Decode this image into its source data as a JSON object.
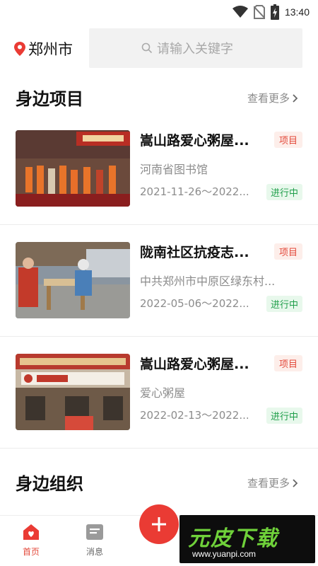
{
  "status_bar": {
    "time": "13:40"
  },
  "header": {
    "city": "郑州市",
    "search_placeholder": "请输入关键字"
  },
  "projects_section": {
    "title": "身边项目",
    "more": "查看更多"
  },
  "projects": [
    {
      "title": "嵩山路爱心粥屋...",
      "tag": "项目",
      "org": "河南省图书馆",
      "date": "2021-11-26～2022...",
      "status": "进行中"
    },
    {
      "title": "陇南社区抗疫志...",
      "tag": "项目",
      "org": "中共郑州市中原区绿东村...",
      "date": "2022-05-06～2022...",
      "status": "进行中"
    },
    {
      "title": "嵩山路爱心粥屋...",
      "tag": "项目",
      "org": "爱心粥屋",
      "date": "2022-02-13～2022...",
      "status": "进行中"
    }
  ],
  "orgs_section": {
    "title": "身边组织",
    "more": "查看更多"
  },
  "tab_bar": {
    "home": "首页",
    "messages": "消息"
  },
  "watermark": {
    "brand": "元皮下载",
    "url": "www.yuanpi.com"
  },
  "colors": {
    "accent": "#ea3b34",
    "tag_bg": "#fdeeea",
    "status_green": "#1f9e4a",
    "status_bg": "#e8f8ec"
  },
  "icons": [
    "wifi-icon",
    "no-sim-icon",
    "battery-charging-icon",
    "location-pin-icon",
    "search-icon",
    "chevron-right-icon",
    "home-heart-icon",
    "message-icon",
    "plus-icon"
  ]
}
